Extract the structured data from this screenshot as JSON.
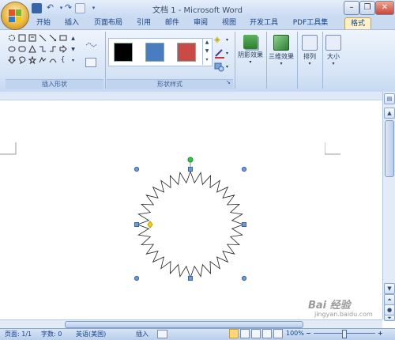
{
  "window": {
    "title": "文档 1 - Microsoft Word",
    "controls": [
      "minimize",
      "restore",
      "close"
    ]
  },
  "quick_access": [
    "save-icon",
    "undo-icon",
    "redo-icon",
    "print-preview-icon"
  ],
  "tabs": [
    {
      "label": "开始"
    },
    {
      "label": "插入"
    },
    {
      "label": "页面布局"
    },
    {
      "label": "引用"
    },
    {
      "label": "邮件"
    },
    {
      "label": "审阅"
    },
    {
      "label": "视图"
    },
    {
      "label": "开发工具"
    },
    {
      "label": "PDF工具集"
    },
    {
      "label": "格式",
      "active": true
    }
  ],
  "ribbon": {
    "insert_shapes": {
      "label": "插入形状"
    },
    "shape_styles": {
      "label": "形状样式",
      "swatches": [
        {
          "name": "black-style",
          "color": "#000000"
        },
        {
          "name": "blue-style",
          "color": "#4a7cc2"
        },
        {
          "name": "red-style",
          "color": "#c94a47"
        }
      ]
    },
    "shadow": {
      "label": "阴影效果"
    },
    "three_d": {
      "label": "三维效果"
    },
    "arrange": {
      "label": "排列"
    },
    "size": {
      "label": "大小"
    }
  },
  "status": {
    "page": "页面: 1/1",
    "words": "字数: 0",
    "language": "英语(美国)",
    "mode": "插入",
    "zoom": "100%",
    "zoom_minus": "−",
    "zoom_plus": "+"
  },
  "watermark": {
    "text": "Bai 经验",
    "url": "jingyan.baidu.com"
  },
  "colors": {
    "ribbon": "#d6e4f6",
    "tab_active": "#fff2c8",
    "selection_handle": "#4a7cc2",
    "rotation_handle": "#2ecc40",
    "adjust_handle": "#f5d400"
  }
}
